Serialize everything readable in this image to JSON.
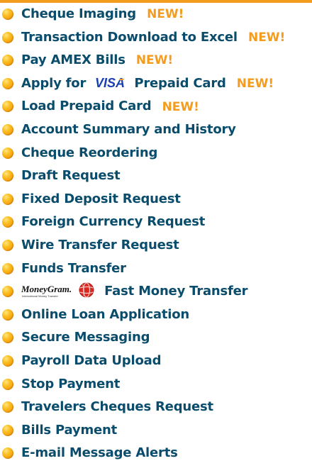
{
  "colors": {
    "accent_orange": "#f39c1f",
    "label_blue": "#0a4c6b",
    "visa_blue": "#1a3fb0",
    "moneygram_red": "#d9281f"
  },
  "new_label": "NEW!",
  "logos": {
    "visa": "VISA",
    "moneygram_wordmark": "MoneyGram.",
    "moneygram_tagline": "International Money Transfer"
  },
  "items": [
    {
      "label": "Cheque Imaging",
      "is_new": true
    },
    {
      "label": "Transaction Download to Excel",
      "is_new": true
    },
    {
      "label": "Pay AMEX Bills",
      "is_new": true
    },
    {
      "label_before": "Apply for",
      "label_after": "Prepaid Card",
      "is_new": true
    },
    {
      "label": "Load Prepaid Card",
      "is_new": true
    },
    {
      "label": "Account Summary and History"
    },
    {
      "label": "Cheque Reordering"
    },
    {
      "label": "Draft Request"
    },
    {
      "label": "Fixed Deposit Request"
    },
    {
      "label": "Foreign Currency Request"
    },
    {
      "label": "Wire Transfer Request"
    },
    {
      "label": "Funds Transfer"
    },
    {
      "label": "Fast Money Transfer"
    },
    {
      "label": "Online Loan Application"
    },
    {
      "label": "Secure Messaging"
    },
    {
      "label": "Payroll Data Upload"
    },
    {
      "label": "Stop Payment"
    },
    {
      "label": "Travelers Cheques Request"
    },
    {
      "label": "Bills Payment"
    },
    {
      "label": "E-mail Message Alerts"
    }
  ]
}
